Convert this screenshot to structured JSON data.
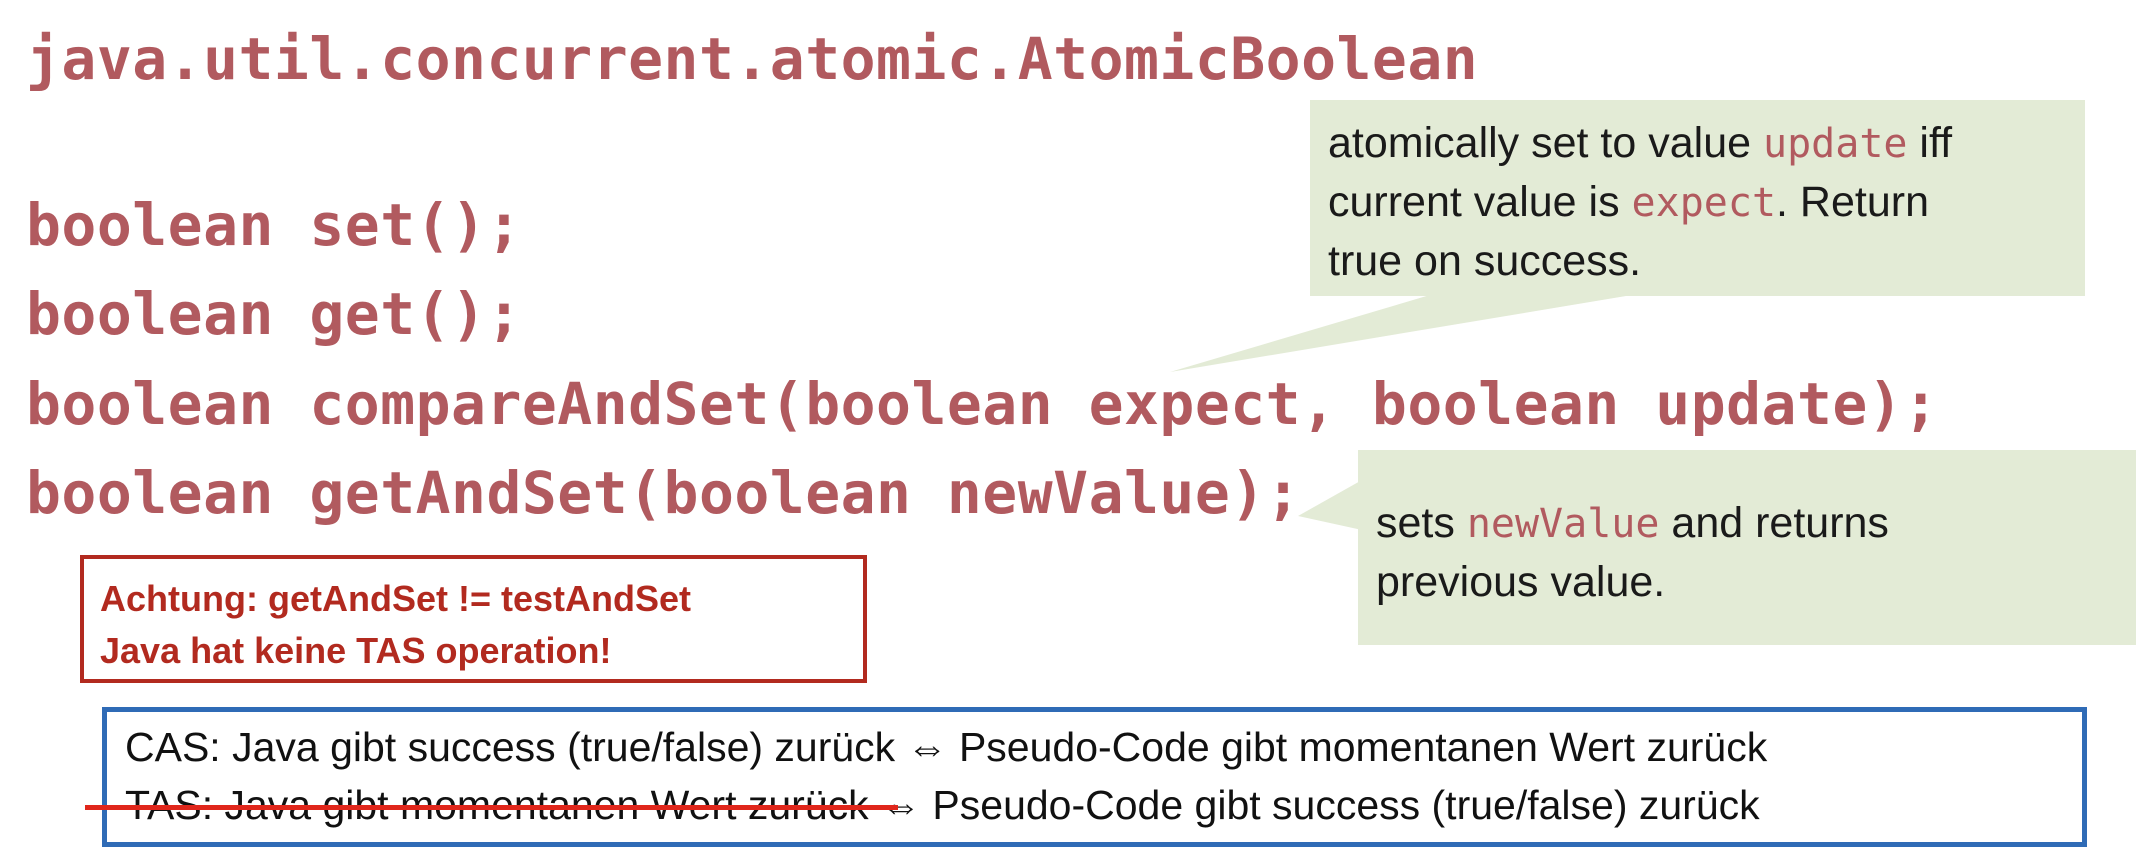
{
  "title": "java.util.concurrent.atomic.AtomicBoolean",
  "code_lines": [
    "boolean set();",
    "boolean get();",
    "boolean compareAndSet(boolean expect, boolean update);",
    "boolean getAndSet(boolean newValue);"
  ],
  "callout_cas": {
    "part1": "atomically set to value ",
    "code1": "update",
    "part2": " iff",
    "part3": "current value is ",
    "code2": "expect",
    "part4": ". Return",
    "part5": "true on success."
  },
  "callout_getandset": {
    "part1": "sets ",
    "code1": "newValue",
    "part2": " and returns",
    "part3": "previous value."
  },
  "warning": {
    "line1": "Achtung: getAndSet != testAndSet",
    "line2": "Java hat keine TAS operation!"
  },
  "note": {
    "cas_line": "CAS: Java gibt success (true/false) zurück ⇔ Pseudo-Code gibt momentanen Wert zurück",
    "tas_struck": "TAS: Java gibt momentanen Wert zurück ",
    "tas_rest": "⇔ Pseudo-Code gibt success (true/false) zurück"
  },
  "colors": {
    "code": "#b15a5f",
    "callout_bg": "#e3ebd6",
    "warning": "#b22a1f",
    "note_border": "#2f6bb6",
    "strike": "#e0261b"
  }
}
